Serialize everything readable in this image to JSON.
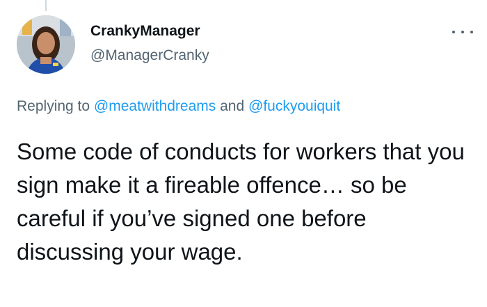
{
  "tweet": {
    "author": {
      "display_name": "CrankyManager",
      "handle": "@ManagerCranky",
      "avatar_icon": "profile-photo"
    },
    "more_icon": "more-horizontal-icon",
    "reply": {
      "prefix": "Replying to",
      "mention_1": "@meatwithdreams",
      "conjunction": "and",
      "mention_2": "@fuckyouiquit"
    },
    "text": "Some code of conducts for workers that you sign make it a fireable offence… so be careful if you’ve signed one before discussing your wage."
  },
  "colors": {
    "text_primary": "#0f1419",
    "text_secondary": "#536471",
    "link": "#1d9bf0",
    "thread_line": "#cfd9de"
  }
}
